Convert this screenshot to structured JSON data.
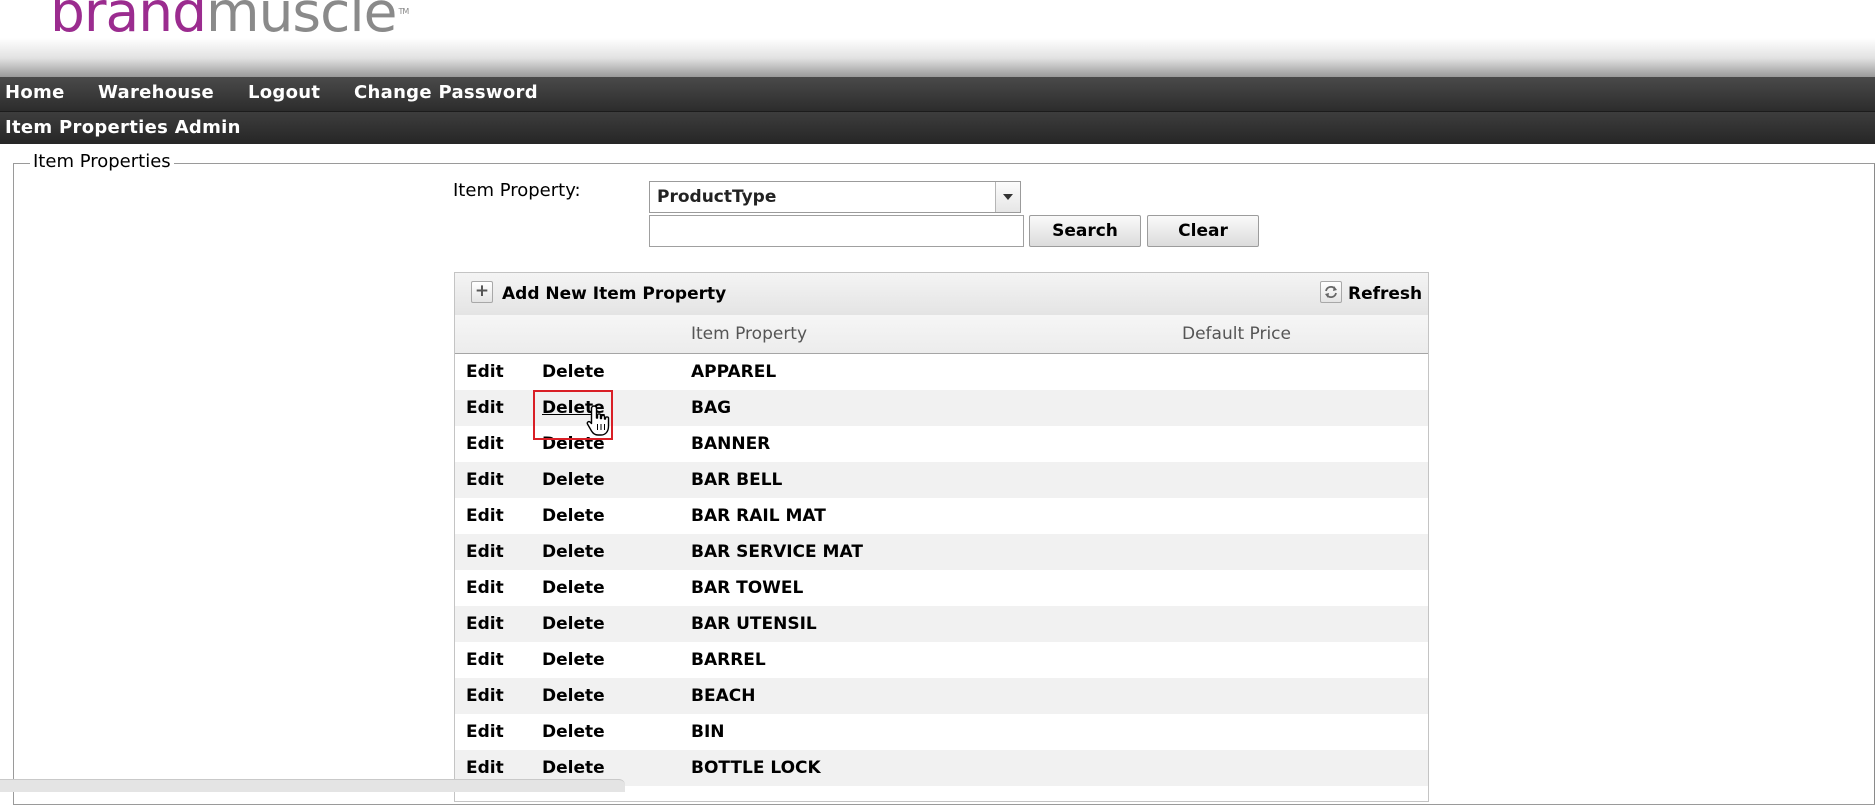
{
  "logo": {
    "brand": "brand",
    "muscle": "muscle",
    "tm": "TM"
  },
  "nav": {
    "items": [
      {
        "label": "Home"
      },
      {
        "label": "Warehouse"
      },
      {
        "label": "Logout"
      },
      {
        "label": "Change Password"
      }
    ]
  },
  "subnav": {
    "title": "Item Properties Admin"
  },
  "panel": {
    "legend": "Item Properties"
  },
  "filter": {
    "label": "Item Property:",
    "selected": "ProductType",
    "search_value": "",
    "search_button": "Search",
    "clear_button": "Clear"
  },
  "grid": {
    "toolbar": {
      "add_label": "Add New Item Property",
      "add_icon": "plus-icon",
      "refresh_label": "Refresh",
      "refresh_icon": "refresh-icon"
    },
    "columns": {
      "col1": "",
      "col2": "",
      "item_property": "Item Property",
      "default_price": "Default Price"
    },
    "rows": [
      {
        "edit": "Edit",
        "delete": "Delete",
        "name": "APPAREL",
        "price": ""
      },
      {
        "edit": "Edit",
        "delete": "Delete",
        "name": "BAG",
        "price": ""
      },
      {
        "edit": "Edit",
        "delete": "Delete",
        "name": "BANNER",
        "price": ""
      },
      {
        "edit": "Edit",
        "delete": "Delete",
        "name": "BAR BELL",
        "price": ""
      },
      {
        "edit": "Edit",
        "delete": "Delete",
        "name": "BAR RAIL MAT",
        "price": ""
      },
      {
        "edit": "Edit",
        "delete": "Delete",
        "name": "BAR SERVICE MAT",
        "price": ""
      },
      {
        "edit": "Edit",
        "delete": "Delete",
        "name": "BAR TOWEL",
        "price": ""
      },
      {
        "edit": "Edit",
        "delete": "Delete",
        "name": "BAR UTENSIL",
        "price": ""
      },
      {
        "edit": "Edit",
        "delete": "Delete",
        "name": "BARREL",
        "price": ""
      },
      {
        "edit": "Edit",
        "delete": "Delete",
        "name": "BEACH",
        "price": ""
      },
      {
        "edit": "Edit",
        "delete": "Delete",
        "name": "BIN",
        "price": ""
      },
      {
        "edit": "Edit",
        "delete": "Delete",
        "name": "BOTTLE LOCK",
        "price": ""
      }
    ]
  },
  "colors": {
    "accent_brand": "#9b2c8f",
    "highlight": "#d91f26",
    "nav_bg": "#2c2c2c"
  }
}
